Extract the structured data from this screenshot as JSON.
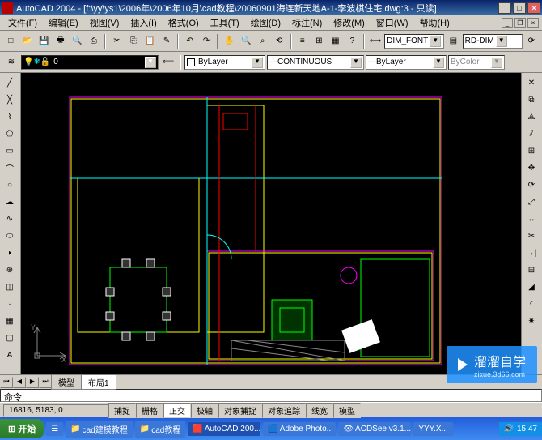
{
  "title": "AutoCAD 2004 - [f:\\yy\\ys1\\2006年\\2006年10月\\cad教程\\20060901海连新天地A-1-李波棋住宅.dwg:3 - 只读]",
  "menu": [
    "文件(F)",
    "编辑(E)",
    "视图(V)",
    "插入(I)",
    "格式(O)",
    "工具(T)",
    "绘图(D)",
    "标注(N)",
    "修改(M)",
    "窗口(W)",
    "帮助(H)"
  ],
  "toolbar2": {
    "layer": "ByLayer",
    "linetype": "CONTINUOUS",
    "lineweight": "ByLayer",
    "color": "ByColor"
  },
  "dim": {
    "font": "DIM_FONT",
    "style": "RD-DIM"
  },
  "tabs": {
    "model": "模型",
    "layout1": "布局1"
  },
  "cmd": "命令:",
  "coords": "16816, 5183, 0",
  "status_buttons": [
    "捕捉",
    "栅格",
    "正交",
    "极轴",
    "对象捕捉",
    "对象追踪",
    "线宽",
    "模型"
  ],
  "taskbar": {
    "start": "开始",
    "items": [
      "cad建模教程",
      "cad教程",
      "AutoCAD 200...",
      "Adobe Photo...",
      "ACDSee v3.1...",
      "YYY.X..."
    ],
    "time": "15:47"
  },
  "watermark": {
    "brand": "溜溜自学",
    "url": "zixue.3d66.com"
  }
}
